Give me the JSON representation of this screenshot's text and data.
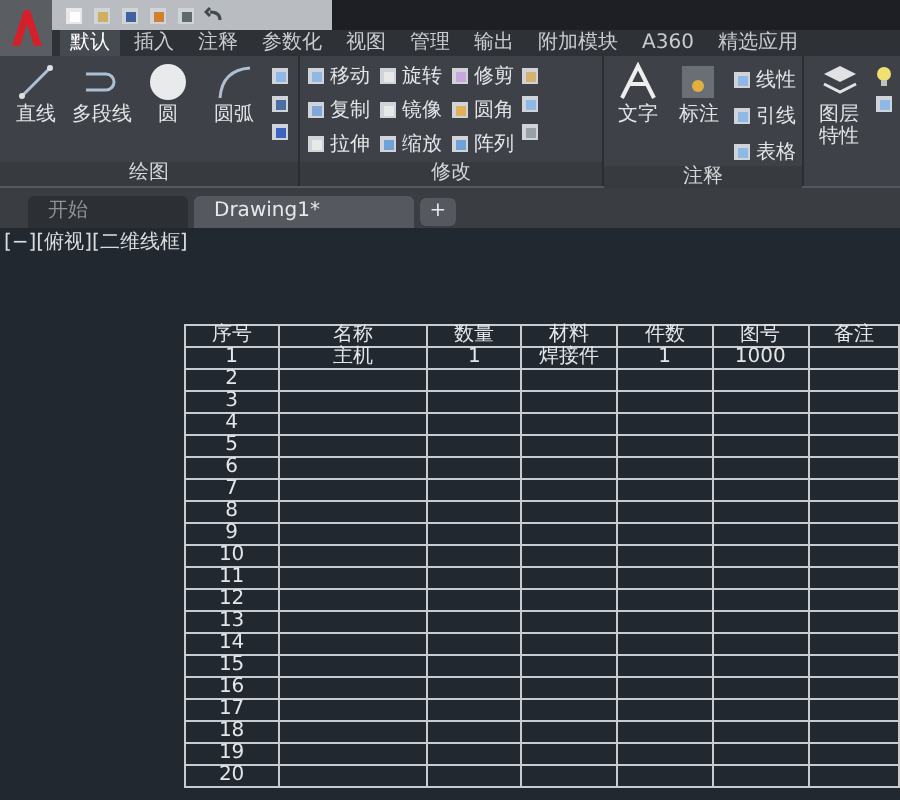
{
  "ribbon_tabs": [
    {
      "label": "默认",
      "selected": true
    },
    {
      "label": "插入",
      "selected": false
    },
    {
      "label": "注释",
      "selected": false
    },
    {
      "label": "参数化",
      "selected": false
    },
    {
      "label": "视图",
      "selected": false
    },
    {
      "label": "管理",
      "selected": false
    },
    {
      "label": "输出",
      "selected": false
    },
    {
      "label": "附加模块",
      "selected": false
    },
    {
      "label": "A360",
      "selected": false
    },
    {
      "label": "精选应用",
      "selected": false
    }
  ],
  "panels": [
    {
      "kind": "draw",
      "title": "绘图",
      "tools": [
        "直线",
        "多段线",
        "圆",
        "圆弧"
      ]
    },
    {
      "kind": "modify",
      "title": "修改",
      "tools": [
        "移动",
        "旋转",
        "修剪",
        "复制",
        "镜像",
        "圆角",
        "拉伸",
        "缩放",
        "阵列"
      ]
    },
    {
      "kind": "annotate",
      "title": "注释",
      "tools": [
        "文字",
        "标注",
        "线性",
        "引线",
        "表格"
      ]
    },
    {
      "kind": "layers",
      "tools": [
        "图层特性"
      ]
    }
  ],
  "doc_tabs": [
    {
      "label": "开始",
      "selected": false
    },
    {
      "label": "Drawing1*",
      "selected": true
    }
  ],
  "new_tab": "+",
  "viewport_label": "[−][俯视][二维线框]",
  "table": {
    "columns": [
      "序号",
      "名称",
      "数量",
      "材料",
      "件数",
      "图号",
      "备注"
    ],
    "rows": [
      [
        "1",
        "主机",
        "1",
        "焊接件",
        "1",
        "1000",
        ""
      ],
      [
        "2"
      ],
      [
        "3"
      ],
      [
        "4"
      ],
      [
        "5"
      ],
      [
        "6"
      ],
      [
        "7"
      ],
      [
        "8"
      ],
      [
        "9"
      ],
      [
        "10"
      ],
      [
        "11"
      ],
      [
        "12"
      ],
      [
        "13"
      ],
      [
        "14"
      ],
      [
        "15"
      ],
      [
        "16"
      ],
      [
        "17"
      ],
      [
        "18"
      ],
      [
        "19"
      ],
      [
        "20"
      ]
    ]
  }
}
